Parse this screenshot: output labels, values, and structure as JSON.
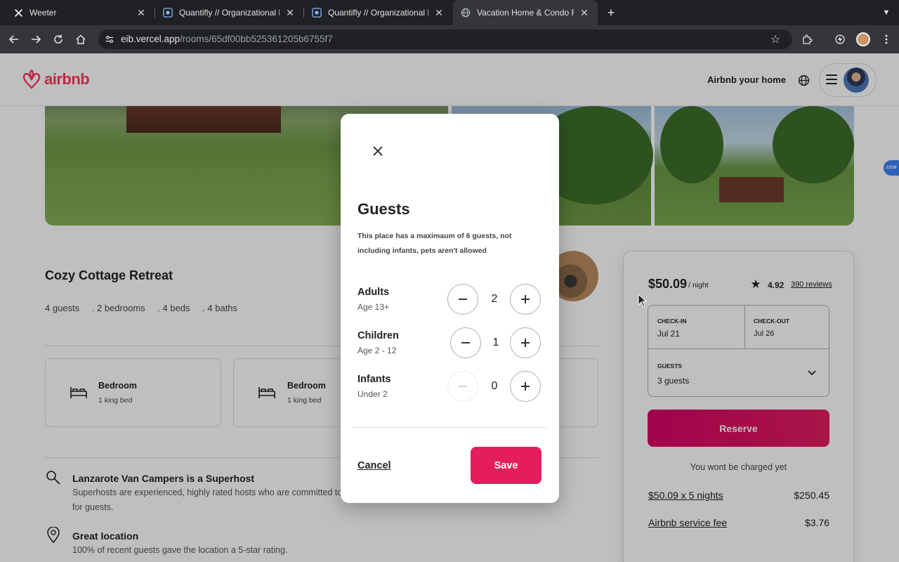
{
  "browser": {
    "tabs": [
      {
        "title": "Weeter",
        "icon": "x-logo-icon"
      },
      {
        "title": "Quantifly // Organizational Dia",
        "icon": "quantifly-icon"
      },
      {
        "title": "Quantifly // Organizational Dia",
        "icon": "quantifly-icon"
      },
      {
        "title": "Vacation Home & Condo Rent",
        "icon": "globe-icon"
      }
    ],
    "url_host": "eib.vercel.app",
    "url_path": "/rooms/65df00bb525361205b6755f7"
  },
  "header": {
    "logo_text": "airbnb",
    "host_link": "Airbnb your home",
    "brand_color": "#ff385c"
  },
  "listing": {
    "title": "Cozy Cottage Retreat",
    "meta": [
      "4 guests",
      ". 2 bedrooms",
      ". 4 beds",
      ". 4 baths"
    ],
    "rooms": [
      {
        "name": "Bedroom",
        "beds": "1 king bed"
      },
      {
        "name": "Bedroom",
        "beds": "1 king bed"
      }
    ],
    "features": [
      {
        "icon": "door-icon",
        "title": "Lanzarote Van Campers is a Superhost",
        "desc": "Superhosts are experienced, highly rated hosts who are committed to p",
        "desc2": "for guests."
      },
      {
        "icon": "location-pin-icon",
        "title": "Great location",
        "desc": "100% of recent guests gave the location a 5-star rating."
      }
    ]
  },
  "booking": {
    "price": "$50.09",
    "per_night": "/ night",
    "rating": "4.92",
    "reviews": "390 reviews",
    "checkin_label": "CHECK-IN",
    "checkin_value": "Jul 21",
    "checkout_label": "CHECK-OUT",
    "checkout_value": "Jul 26",
    "guests_label": "GUESTS",
    "guests_value": "3 guests",
    "reserve_label": "Reserve",
    "no_charge": "You wont be charged yet",
    "line_items": [
      {
        "label": "$50.09 x 5 nights",
        "value": "$250.45"
      },
      {
        "label": "Airbnb service fee",
        "value": "$3.76"
      }
    ],
    "reserve_color": "#e31c5f"
  },
  "side_badge": "131M",
  "modal": {
    "title": "Guests",
    "note": "This place has a maximaum of 6 guests, not including infants, pets aren't allowed",
    "rows": [
      {
        "label": "Adults",
        "sub": "Age 13+",
        "count": "2",
        "minus_enabled": true
      },
      {
        "label": "Children",
        "sub": "Age 2 - 12",
        "count": "1",
        "minus_enabled": true
      },
      {
        "label": "Infants",
        "sub": "Under 2",
        "count": "0",
        "minus_enabled": false
      }
    ],
    "cancel_label": "Cancel",
    "save_label": "Save"
  }
}
